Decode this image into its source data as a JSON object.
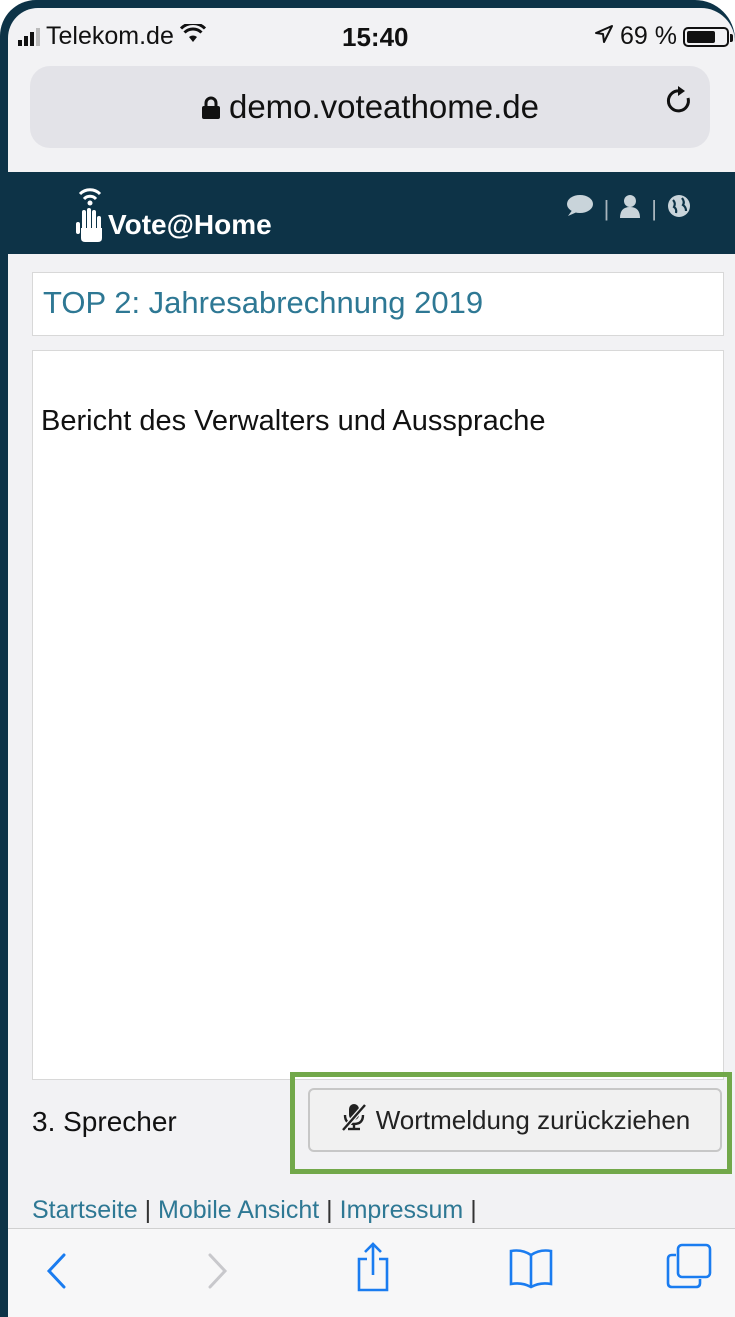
{
  "status_bar": {
    "carrier": "Telekom.de",
    "time": "15:40",
    "battery": "69 %"
  },
  "browser": {
    "url": "demo.voteathome.de"
  },
  "app": {
    "logo_text": "Vote@Home",
    "header_icons": [
      "chat-icon",
      "user-icon",
      "globe-icon"
    ]
  },
  "agenda": {
    "title": "TOP 2: Jahresabrechnung 2019",
    "body": "Bericht des Verwalters und Aussprache"
  },
  "speaker": {
    "label": "3. Sprecher",
    "withdraw_button": "Wortmeldung zurückziehen"
  },
  "footer": {
    "links": [
      "Startseite",
      "Mobile Ansicht",
      "Impressum"
    ],
    "separator": "|"
  },
  "colors": {
    "header_bg": "#0d3347",
    "title_text": "#2e7894",
    "highlight_border": "#72a84a",
    "ios_blue": "#1a7cf0"
  }
}
